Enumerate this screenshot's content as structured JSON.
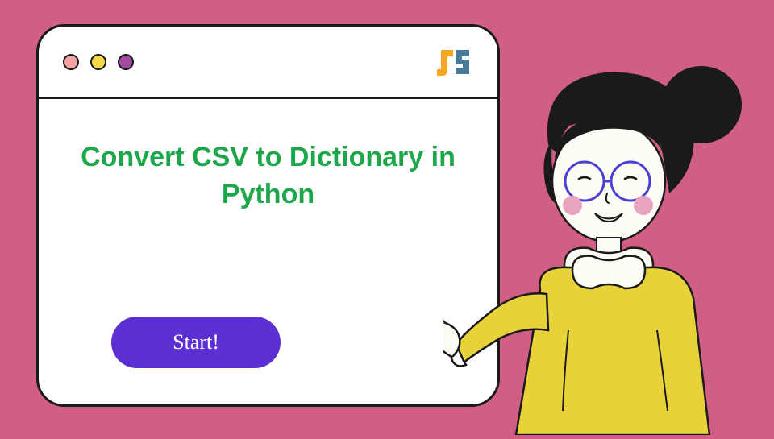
{
  "window": {
    "heading": "Convert CSV to Dictionary in Python",
    "button_label": "Start!",
    "logo_name": "J2 logo"
  },
  "titlebar": {
    "dots": [
      "red",
      "yellow",
      "purple"
    ]
  },
  "colors": {
    "background": "#d15e83",
    "heading": "#1ca84a",
    "button": "#5b2fd4",
    "character_shirt": "#e8d23a",
    "character_hair": "#1a1a1a"
  }
}
